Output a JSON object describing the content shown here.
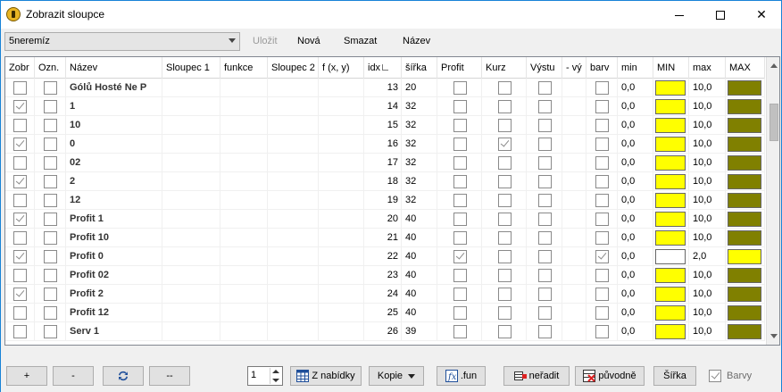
{
  "window": {
    "title": "Zobrazit sloupce",
    "minimize_icon": "minimize-icon",
    "maximize_icon": "maximize-icon",
    "close_icon": "close-icon",
    "close_label": "✕"
  },
  "toolbar": {
    "profile_value": "5neremíz",
    "save_label": "Uložit",
    "new_label": "Nová",
    "delete_label": "Smazat",
    "name_label": "Název"
  },
  "grid": {
    "headers": [
      "Zobr",
      "Ozn.",
      "Název",
      "Sloupec 1",
      "funkce",
      "Sloupec 2",
      "f (x, y)",
      "idx",
      "šířka",
      "Profit",
      "Kurz",
      "Výstu",
      "- vý",
      "barv",
      "min",
      "MIN",
      "max",
      "MAX"
    ],
    "rows": [
      {
        "zobr": false,
        "ozn": false,
        "nazev": "Gólů Hosté Ne P",
        "idx": "13",
        "sirka": "20",
        "profit": false,
        "kurz": false,
        "vystup": false,
        "barva": false,
        "min": "0,0",
        "min_color": "#ffff00",
        "max": "10,0",
        "max_color": "#808000"
      },
      {
        "zobr": true,
        "ozn": false,
        "nazev": "1",
        "idx": "14",
        "sirka": "32",
        "profit": false,
        "kurz": false,
        "vystup": false,
        "barva": false,
        "min": "0,0",
        "min_color": "#ffff00",
        "max": "10,0",
        "max_color": "#808000"
      },
      {
        "zobr": false,
        "ozn": false,
        "nazev": "10",
        "idx": "15",
        "sirka": "32",
        "profit": false,
        "kurz": false,
        "vystup": false,
        "barva": false,
        "min": "0,0",
        "min_color": "#ffff00",
        "max": "10,0",
        "max_color": "#808000"
      },
      {
        "zobr": true,
        "ozn": false,
        "nazev": "0",
        "idx": "16",
        "sirka": "32",
        "profit": false,
        "kurz": true,
        "vystup": false,
        "barva": false,
        "min": "0,0",
        "min_color": "#ffff00",
        "max": "10,0",
        "max_color": "#808000"
      },
      {
        "zobr": false,
        "ozn": false,
        "nazev": "02",
        "idx": "17",
        "sirka": "32",
        "profit": false,
        "kurz": false,
        "vystup": false,
        "barva": false,
        "min": "0,0",
        "min_color": "#ffff00",
        "max": "10,0",
        "max_color": "#808000"
      },
      {
        "zobr": true,
        "ozn": false,
        "nazev": "2",
        "idx": "18",
        "sirka": "32",
        "profit": false,
        "kurz": false,
        "vystup": false,
        "barva": false,
        "min": "0,0",
        "min_color": "#ffff00",
        "max": "10,0",
        "max_color": "#808000"
      },
      {
        "zobr": false,
        "ozn": false,
        "nazev": "12",
        "idx": "19",
        "sirka": "32",
        "profit": false,
        "kurz": false,
        "vystup": false,
        "barva": false,
        "min": "0,0",
        "min_color": "#ffff00",
        "max": "10,0",
        "max_color": "#808000"
      },
      {
        "zobr": true,
        "ozn": false,
        "nazev": "Profit 1",
        "idx": "20",
        "sirka": "40",
        "profit": false,
        "kurz": false,
        "vystup": false,
        "barva": false,
        "min": "0,0",
        "min_color": "#ffff00",
        "max": "10,0",
        "max_color": "#808000"
      },
      {
        "zobr": false,
        "ozn": false,
        "nazev": "Profit 10",
        "idx": "21",
        "sirka": "40",
        "profit": false,
        "kurz": false,
        "vystup": false,
        "barva": false,
        "min": "0,0",
        "min_color": "#ffff00",
        "max": "10,0",
        "max_color": "#808000"
      },
      {
        "zobr": true,
        "ozn": false,
        "nazev": "Profit 0",
        "idx": "22",
        "sirka": "40",
        "profit": true,
        "kurz": false,
        "vystup": false,
        "barva": true,
        "min": "0,0",
        "min_color": "#ffffff",
        "max": "2,0",
        "max_color": "#ffff00"
      },
      {
        "zobr": false,
        "ozn": false,
        "nazev": "Profit 02",
        "idx": "23",
        "sirka": "40",
        "profit": false,
        "kurz": false,
        "vystup": false,
        "barva": false,
        "min": "0,0",
        "min_color": "#ffff00",
        "max": "10,0",
        "max_color": "#808000"
      },
      {
        "zobr": true,
        "ozn": false,
        "nazev": "Profit 2",
        "idx": "24",
        "sirka": "40",
        "profit": false,
        "kurz": false,
        "vystup": false,
        "barva": false,
        "min": "0,0",
        "min_color": "#ffff00",
        "max": "10,0",
        "max_color": "#808000"
      },
      {
        "zobr": false,
        "ozn": false,
        "nazev": "Profit 12",
        "idx": "25",
        "sirka": "40",
        "profit": false,
        "kurz": false,
        "vystup": false,
        "barva": false,
        "min": "0,0",
        "min_color": "#ffff00",
        "max": "10,0",
        "max_color": "#808000"
      },
      {
        "zobr": false,
        "ozn": false,
        "nazev": "Serv 1",
        "idx": "26",
        "sirka": "39",
        "profit": false,
        "kurz": false,
        "vystup": false,
        "barva": false,
        "min": "0,0",
        "min_color": "#ffff00",
        "max": "10,0",
        "max_color": "#808000"
      }
    ]
  },
  "bottombar": {
    "add_label": "+",
    "remove_label": "-",
    "refresh_icon": "refresh-icon",
    "clear_label": "--",
    "page_value": "1",
    "from_menu_label": "Z nabídky",
    "copy_label": "Kopie",
    "fun_label": ".fun",
    "nosort_label": "neřadit",
    "original_label": "původně",
    "width_label": "Šířka",
    "colors_label": "Barvy",
    "colors_checked": true
  }
}
